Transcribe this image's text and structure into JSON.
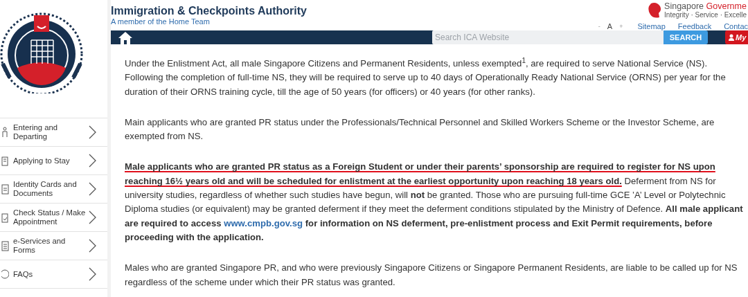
{
  "header": {
    "title": "Immigration & Checkpoints Authority",
    "subtitle": "A member of the Home Team"
  },
  "gov_brand": {
    "name": "Singapore",
    "name_highlight": "Governme",
    "tagline": "Integrity · Service · Excelle"
  },
  "utility": {
    "font_controls": [
      "-",
      "A",
      "+"
    ],
    "links": [
      "Sitemap",
      "Feedback",
      "Contac"
    ]
  },
  "nav": {
    "search": {
      "placeholder": "Search ICA Website"
    },
    "search_button": "SEARCH",
    "login_button": "My"
  },
  "sidebar": {
    "items": [
      {
        "label": "Entering and Departing",
        "kind": "person"
      },
      {
        "label": "Applying to Stay",
        "kind": "building"
      },
      {
        "label": "Identity Cards and Documents",
        "kind": "card"
      },
      {
        "label": "Check Status / Make Appointment",
        "kind": "clipboard"
      },
      {
        "label": "e-Services and Forms",
        "kind": "form"
      },
      {
        "label": "FAQs",
        "kind": "circle"
      }
    ]
  },
  "content": {
    "paragraphs": [
      {
        "parts": [
          {
            "kind": "text",
            "text": "Under the Enlistment Act, all male Singapore Citizens and Permanent Residents, unless exempted$^{1}$, are required to serve National Service (NS). Following the completion of full-time NS, they will be required to serve up to 40 days of Operationally Ready National Service (ORNS) per year for the duration of their ORNS training cycle, till the age of 50 years (for officers) or 40 years (for other ranks)."
          }
        ]
      },
      {
        "parts": [
          {
            "kind": "text",
            "text": "Main applicants who are granted PR status under the Professionals/Technical Personnel and Skilled Workers Scheme or the Investor Scheme, are exempted from NS."
          }
        ]
      },
      {
        "parts": [
          {
            "kind": "text",
            "underlined": true,
            "text": "**Male applicants who are granted PR status as a Foreign Student or under their parents’ sponsorship are required to register for NS upon reaching 16½ years old and will be scheduled for enlistment at the earliest opportunity upon reaching 18 years old.**"
          },
          {
            "kind": "text",
            "underlined": false,
            "text": " Deferment from NS for university studies, regardless of whether such studies have begun, will **not** be granted. Those who are pursuing full-time GCE ’A’ Level or Polytechnic Diploma studies (or equivalent) may be granted deferment if they meet the deferment conditions stipulated by the Ministry of Defence. **All male applicant**"
          },
          {
            "kind": "text",
            "underlined": false,
            "text": "**are required to access** "
          },
          {
            "kind": "link",
            "text": "www.cmpb.gov.sg"
          },
          {
            "kind": "text",
            "underlined": false,
            "text": " **for information on NS deferment, pre-enlistment process and Exit Permit requirements, before proceeding with the application.**"
          }
        ]
      },
      {
        "parts": [
          {
            "kind": "text",
            "text": "Males who are granted Singapore PR, and who were previously Singapore Citizens or Singapore Permanent Residents, are liable to be called up for NS regardless of the scheme under which their PR status was granted."
          }
        ]
      }
    ]
  }
}
